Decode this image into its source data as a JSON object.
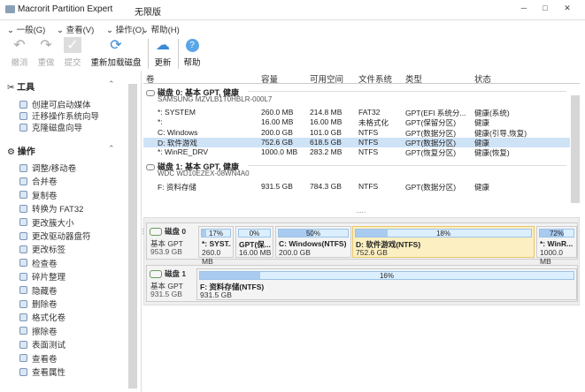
{
  "window": {
    "title": "Macrorit Partition Expert",
    "edition": "无限版",
    "min": "─",
    "max": "□",
    "close": "✕"
  },
  "menu": [
    "一般(G)",
    "查看(V)",
    "操作(O)",
    "帮助(H)"
  ],
  "toolbar": {
    "undo": "撤消",
    "redo": "重做",
    "commit": "提交",
    "reload": "重新加载磁盘",
    "update": "更新",
    "help": "帮助"
  },
  "sidebar": {
    "tools_title": "工具",
    "tools": [
      "创建可启动媒体",
      "迁移操作系统向导",
      "克隆磁盘向导"
    ],
    "ops_title": "操作",
    "ops": [
      "调整/移动卷",
      "合并卷",
      "复制卷",
      "转换为 FAT32",
      "更改簇大小",
      "更改驱动器盘符",
      "更改标签",
      "检查卷",
      "碎片整理",
      "隐藏卷",
      "删除卷",
      "格式化卷",
      "擦除卷",
      "表面测试",
      "查看卷",
      "查看属性"
    ]
  },
  "columns": [
    "卷",
    "容量",
    "可用空间",
    "文件系统",
    "类型",
    "状态"
  ],
  "disks": [
    {
      "header": "磁盘  0: 基本 GPT, 健康",
      "model": "SAMSUNG MZVLB1T0HBLR-000L7",
      "rows": [
        [
          "*: SYSTEM",
          "260.0 MB",
          "214.8 MB",
          "FAT32",
          "GPT(EFI 系统分...",
          "健康(系统)"
        ],
        [
          "*:",
          "16.00 MB",
          "16.00 MB",
          "未格式化",
          "GPT(保留分区)",
          "健康"
        ],
        [
          "C: Windows",
          "200.0 GB",
          "101.0 GB",
          "NTFS",
          "GPT(数据分区)",
          "健康(引导,恢复)"
        ],
        [
          "D: 软件游戏",
          "752.6 GB",
          "618.5 GB",
          "NTFS",
          "GPT(数据分区)",
          "健康"
        ],
        [
          "*: WinRE_DRV",
          "1000.0 MB",
          "283.2 MB",
          "NTFS",
          "GPT(恢复分区)",
          "健康(恢复)"
        ]
      ]
    },
    {
      "header": "磁盘  1: 基本 GPT, 健康",
      "model": "WDC WD10EZEX-08WN4A0",
      "rows": [
        [
          "F: 资料存储",
          "931.5 GB",
          "784.3 GB",
          "NTFS",
          "GPT(数据分区)",
          "健康"
        ]
      ]
    }
  ],
  "map": [
    {
      "name": "磁盘",
      "num": "0",
      "type": "基本 GPT",
      "size": "953.9 GB",
      "parts": [
        {
          "pct": "17%",
          "used": 17,
          "name": "*: SYST...",
          "size": "260.0 MB"
        },
        {
          "pct": "0%",
          "used": 0,
          "name": "GPT(保...",
          "size": "16.00 MB"
        },
        {
          "pct": "50%",
          "used": 50,
          "name": "C: Windows(NTFS)",
          "size": "200.0 GB"
        },
        {
          "pct": "18%",
          "used": 18,
          "name": "D: 软件游戏(NTFS)",
          "size": "752.6 GB"
        },
        {
          "pct": "72%",
          "used": 72,
          "name": "*: WinR...",
          "size": "1000.0 MB"
        }
      ]
    },
    {
      "name": "磁盘",
      "num": "1",
      "type": "基本 GPT",
      "size": "931.5 GB",
      "parts": [
        {
          "pct": "16%",
          "used": 16,
          "name": "F: 资料存储(NTFS)",
          "size": "931.5 GB"
        }
      ]
    }
  ],
  "colors": {
    "selected_row": "#cfe3f7",
    "selected_part": "#fcefc1",
    "bar_fill": "#a9cbef"
  }
}
